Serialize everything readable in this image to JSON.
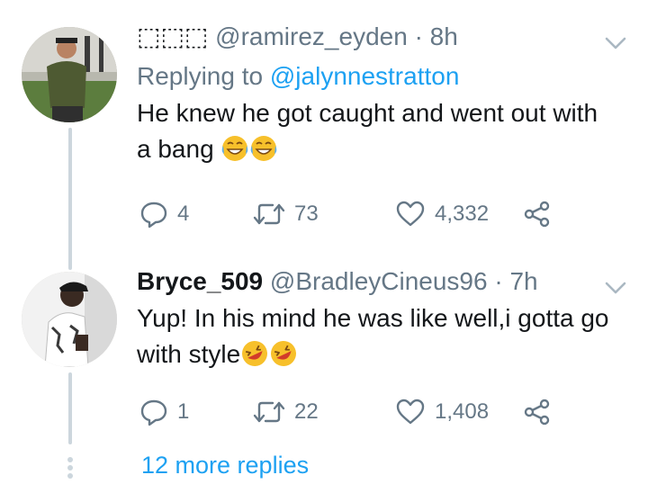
{
  "tweet1": {
    "display_name": "⬚⬚⬚",
    "handle": "@ramirez_eyden",
    "separator": "·",
    "time": "8h",
    "replying_label": "Replying to",
    "replying_mention": "@jalynnestratton",
    "text": "He knew he got caught and went out with a bang",
    "emojis": [
      "laughing-tears-emoji",
      "laughing-tears-emoji"
    ],
    "replies": "4",
    "retweets": "73",
    "likes": "4,332"
  },
  "tweet2": {
    "display_name": "Bryce_509",
    "handle": "@BradleyCineus96",
    "separator": "·",
    "time": "7h",
    "text": "Yup! In his mind he was like well,i gotta go with style",
    "emojis": [
      "rofl-emoji",
      "rofl-emoji"
    ],
    "replies": "1",
    "retweets": "22",
    "likes": "1,408"
  },
  "more_replies": "12 more replies",
  "colors": {
    "accent": "#1da1f2",
    "secondary_text": "#657786",
    "thread_line": "#ccd6dd",
    "emoji_yellow": "#f7c02b"
  },
  "icons": [
    "chevron-down-icon",
    "reply-icon",
    "retweet-icon",
    "like-icon",
    "share-icon"
  ]
}
